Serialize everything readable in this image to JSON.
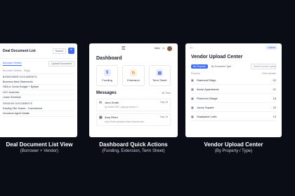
{
  "screens": {
    "list_view": {
      "title": "Deal Document List",
      "search_label": "Search",
      "add_label": "+",
      "tab_label": "Borrower Details",
      "upload_label": "Upload Document",
      "rows": [
        {
          "text": "Borrower Details - Stage",
          "sub": true
        },
        {
          "text": "BORROWER DOCUMENTS",
          "section": true
        },
        {
          "text": "Business Bank Statements"
        },
        {
          "text": "HDA or Condo Budget + Bylaws"
        },
        {
          "text": "UCC searches"
        },
        {
          "text": "Lease Schedule"
        },
        {
          "text": "VENDOR DOCUMENTS",
          "section": true
        },
        {
          "text": "Existing Title Search - Commitment"
        },
        {
          "text": "Insurance Agent Details"
        }
      ]
    },
    "dashboard": {
      "menu_icon": "hamburger-icon",
      "new_label": "New",
      "title": "Dashboard",
      "actions": [
        {
          "label": "Funding",
          "glyph": "$",
          "color": "#3b6cf5",
          "bg": "#e8eefe"
        },
        {
          "label": "Extension",
          "glyph": "↻",
          "color": "#e28a1d",
          "bg": "#fdf1e1"
        },
        {
          "label": "Term Sheet",
          "glyph": "▤",
          "color": "#3b6cf5",
          "bg": "#e8eefe"
        }
      ],
      "messages_title": "Messages",
      "messages_all": "All Time",
      "messages": [
        {
          "icon": "✉",
          "name": "John Smith",
          "text": "by Smith 1997, paying result,LC...",
          "date": "May 16"
        },
        {
          "icon": "▦",
          "name": "Amy Reed",
          "text": "Amy Reed uploaded three documents...",
          "date": "May 16"
        }
      ]
    },
    "vendor": {
      "back_icon": "←",
      "pill": "Upload",
      "title": "Vendor Upload Center",
      "tabs": [
        "By Property",
        "By Document Type"
      ],
      "search_placeholder": "Search vendor uploads...",
      "col_left": "Property",
      "col_right": "Total Uploads",
      "rows": [
        {
          "name": "Diamond Ridge",
          "count": "22"
        },
        {
          "name": "Acme Apartments",
          "count": "21"
        },
        {
          "name": "Pinecrest Village",
          "count": "18"
        },
        {
          "name": "Jones Square",
          "count": "22"
        },
        {
          "name": "Shadyside Lofts",
          "count": "13"
        }
      ]
    }
  },
  "captions": [
    {
      "title": "Deal Document  List View",
      "sub": "(Borrower + Vendor)"
    },
    {
      "title": "Dashboard Quick Actions",
      "sub": "(Funding, Extension, Term Sheet)"
    },
    {
      "title": "Vendor Upload Center",
      "sub": "(By Property / Type)"
    }
  ]
}
